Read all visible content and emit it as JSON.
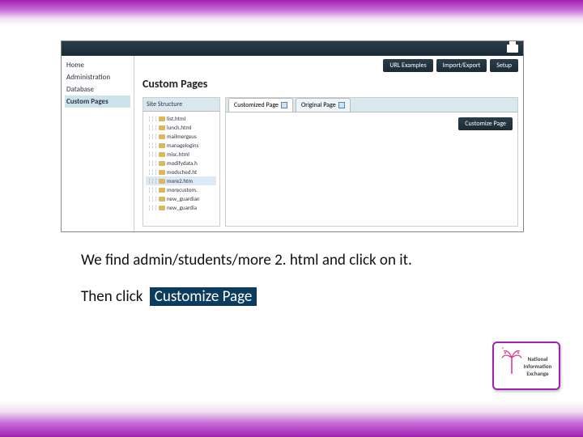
{
  "sidebar": {
    "items": [
      {
        "label": "Home"
      },
      {
        "label": "Administration"
      },
      {
        "label": "Database"
      },
      {
        "label": "Custom Pages",
        "selected": true
      }
    ]
  },
  "toolbar": {
    "url_examples": "URL Examples",
    "import_export": "Import/Export",
    "setup": "Setup"
  },
  "page_title": "Custom Pages",
  "site_structure_label": "Site Structure",
  "tree": {
    "items": [
      {
        "label": "list.html"
      },
      {
        "label": "lunch.html"
      },
      {
        "label": "mailmergeus"
      },
      {
        "label": "managelogins"
      },
      {
        "label": "misc.html"
      },
      {
        "label": "modifydata.h"
      },
      {
        "label": "modsched.ht"
      },
      {
        "label": "more2.htm",
        "selected": true
      },
      {
        "label": "morecustom."
      },
      {
        "label": "new_guardian"
      },
      {
        "label": "new_guardia"
      }
    ]
  },
  "tabs": {
    "customized": "Customized Page",
    "original": "Original Page"
  },
  "customize_btn": "Customize Page",
  "instruction1": "We find admin/students/more 2. html and click on it.",
  "instruction2_pre": "Then click",
  "instruction2_chip": "  Customize Page",
  "logo_text": "National Information Exchange"
}
